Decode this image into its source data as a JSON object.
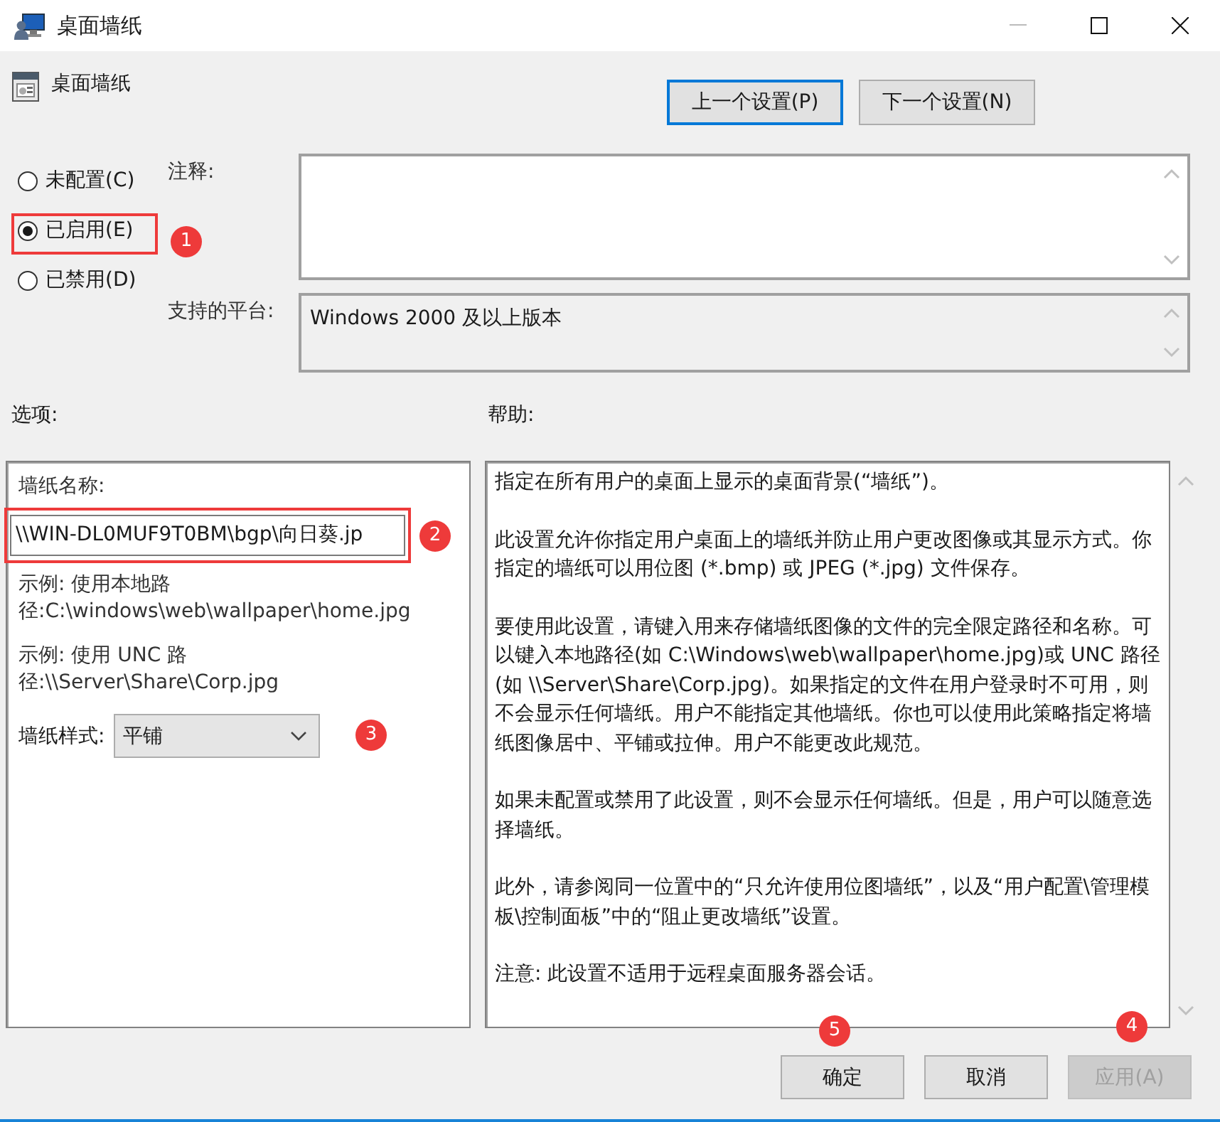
{
  "window": {
    "title": "桌面墙纸"
  },
  "policy": {
    "name": "桌面墙纸"
  },
  "nav_buttons": [
    {
      "label": "上一个设置(P)",
      "focused": true
    },
    {
      "label": "下一个设置(N)",
      "focused": false
    }
  ],
  "state_options": [
    {
      "label": "未配置(C)",
      "selected": false,
      "highlighted": false
    },
    {
      "label": "已启用(E)",
      "selected": true,
      "highlighted": true,
      "callout": "1"
    },
    {
      "label": "已禁用(D)",
      "selected": false,
      "highlighted": false
    }
  ],
  "comment": {
    "label": "注释:"
  },
  "platform": {
    "label": "支持的平台:",
    "value": "Windows 2000 及以上版本"
  },
  "options": {
    "heading": "选项:",
    "items": [
      {
        "kind": "text-field",
        "label": "墙纸名称:",
        "value": "\\\\WIN-DL0MUF9T0BM\\bgp\\向日葵.jp",
        "highlighted": true,
        "callout": "2"
      },
      {
        "kind": "note",
        "text": "示例: 使用本地路径:C:\\windows\\web\\wallpaper\\home.jpg"
      },
      {
        "kind": "note",
        "text": "示例: 使用 UNC 路径:\\\\Server\\Share\\Corp.jpg"
      },
      {
        "kind": "dropdown",
        "label": "墙纸样式:",
        "value": "平铺",
        "callout": "3"
      }
    ]
  },
  "help": {
    "heading": "帮助:",
    "paragraphs": [
      "指定在所有用户的桌面上显示的桌面背景(“墙纸”)。",
      "此设置允许你指定用户桌面上的墙纸并防止用户更改图像或其显示方式。你指定的墙纸可以用位图 (*.bmp) 或 JPEG (*.jpg) 文件保存。",
      "要使用此设置，请键入用来存储墙纸图像的文件的完全限定路径和名称。可以键入本地路径(如 C:\\Windows\\web\\wallpaper\\home.jpg)或 UNC 路径(如 \\\\Server\\Share\\Corp.jpg)。如果指定的文件在用户登录时不可用，则不会显示任何墙纸。用户不能指定其他墙纸。你也可以使用此策略指定将墙纸图像居中、平铺或拉伸。用户不能更改此规范。",
      "如果未配置或禁用了此设置，则不会显示任何墙纸。但是，用户可以随意选择墙纸。",
      "此外，请参阅同一位置中的“只允许使用位图墙纸”，以及“用户配置\\管理模板\\控制面板”中的“阻止更改墙纸”设置。",
      "注意: 此设置不适用于远程桌面服务器会话。"
    ]
  },
  "buttons": [
    {
      "label": "确定",
      "disabled": false,
      "callout": "5"
    },
    {
      "label": "取消",
      "disabled": false
    },
    {
      "label": "应用(A)",
      "disabled": true,
      "callout": "4"
    }
  ]
}
